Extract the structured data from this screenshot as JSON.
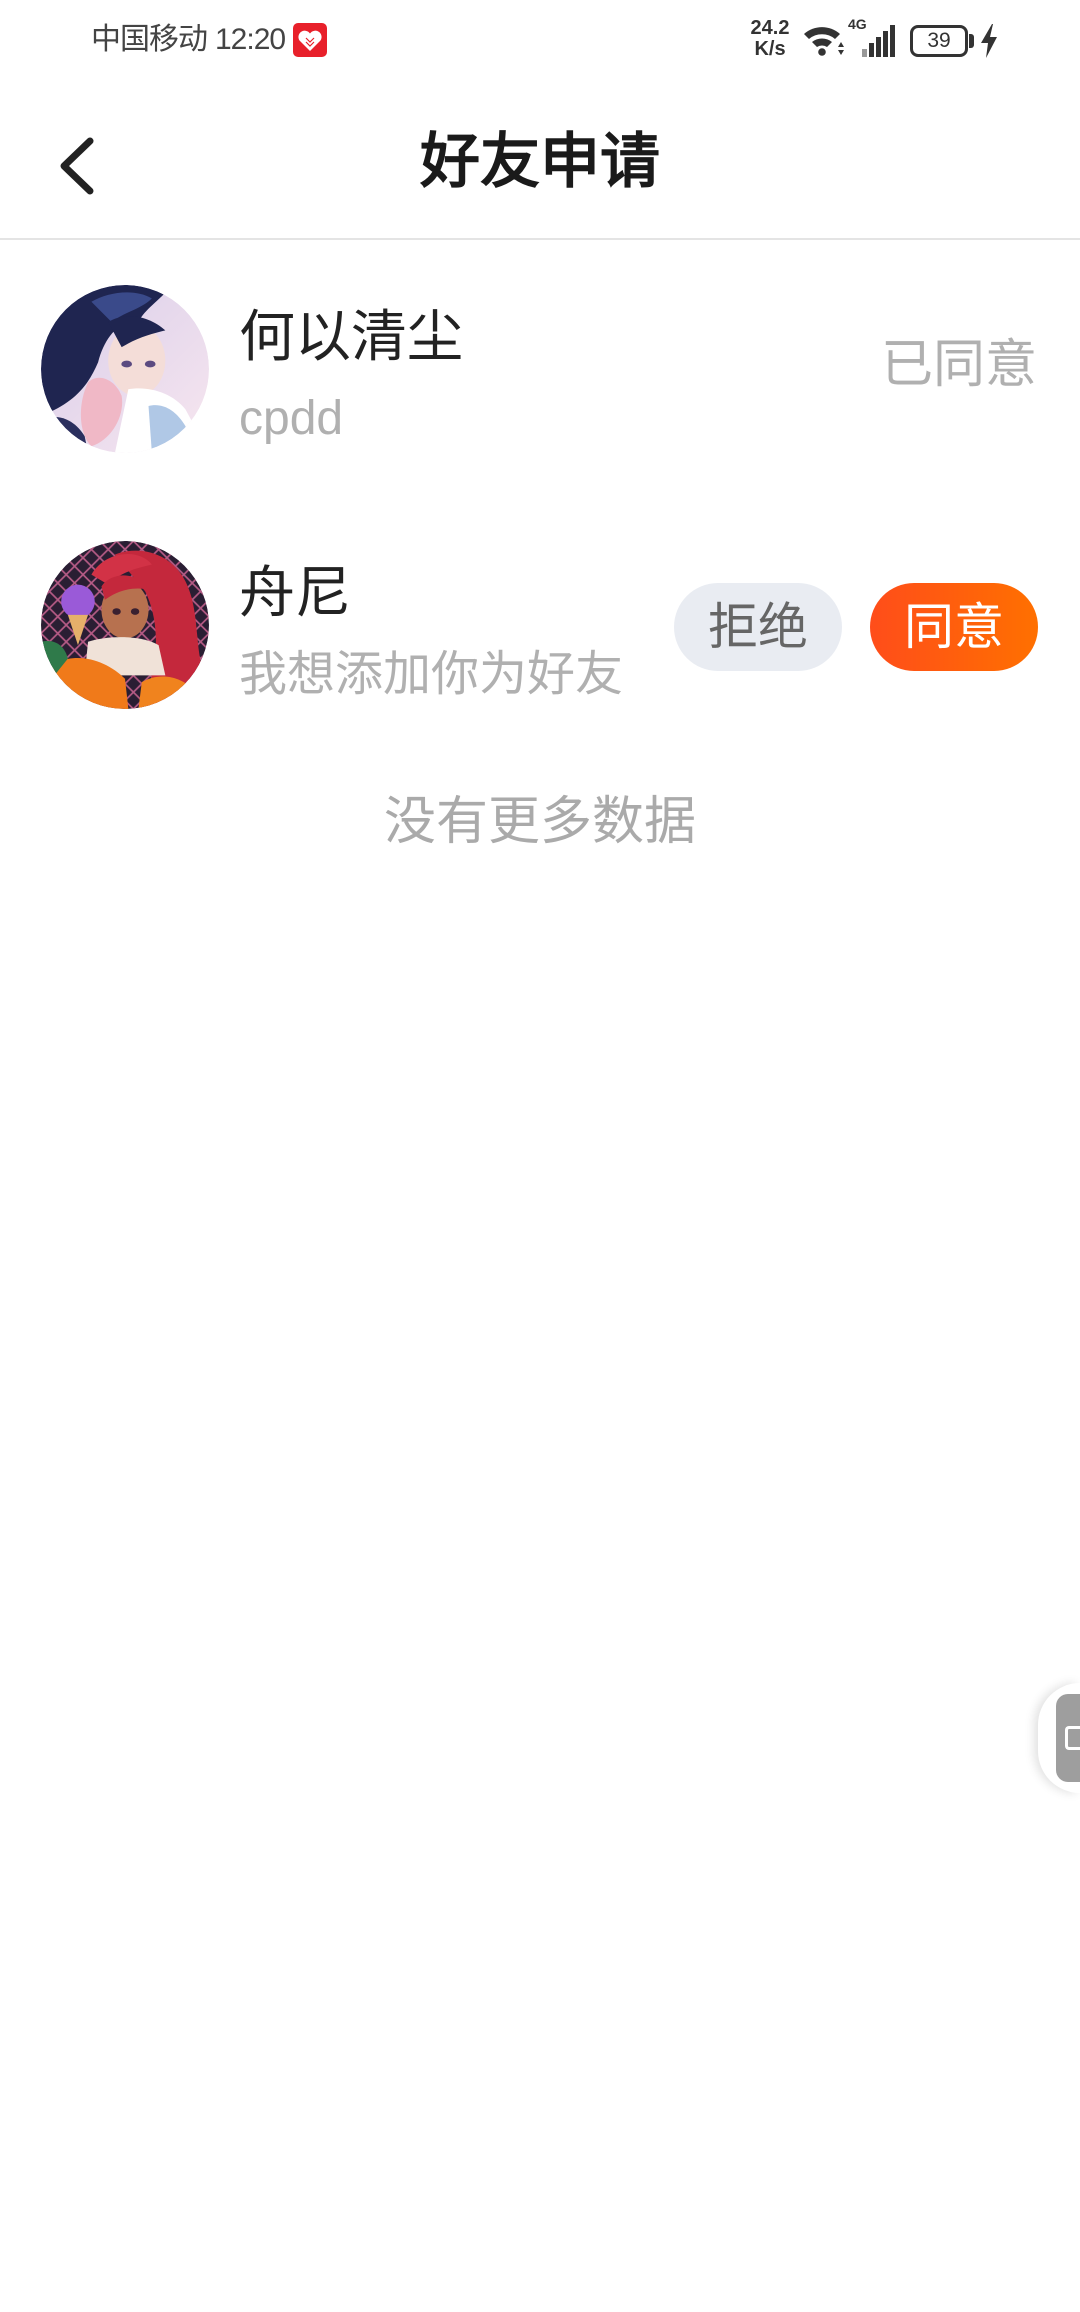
{
  "status_bar": {
    "carrier": "中国移动",
    "time": "12:20",
    "net_speed_value": "24.2",
    "net_speed_unit": "K/s",
    "network_type": "4G",
    "battery_level": "39",
    "icons": {
      "badge": "heart-icon",
      "wifi": "wifi-icon",
      "signal": "signal-icon",
      "battery": "battery-icon",
      "charging": "charging-icon"
    }
  },
  "header": {
    "title": "好友申请",
    "back_icon": "chevron-left-icon"
  },
  "requests": [
    {
      "name": "何以清尘",
      "message": "cpdd",
      "status": "已同意"
    },
    {
      "name": "舟尼",
      "message": "我想添加你为好友",
      "reject_label": "拒绝",
      "accept_label": "同意"
    }
  ],
  "list_footer": {
    "text": "没有更多数据"
  },
  "floating_button": {
    "icon": "floating-assistant-icon"
  },
  "colors": {
    "accent": "#ff4d1a",
    "accent_end": "#ff7000",
    "reject_bg": "#e9ecf2",
    "muted_text": "#b0b0b0",
    "primary_text": "#222222",
    "divider": "#e4e4e4",
    "badge_red": "#e8202a"
  }
}
